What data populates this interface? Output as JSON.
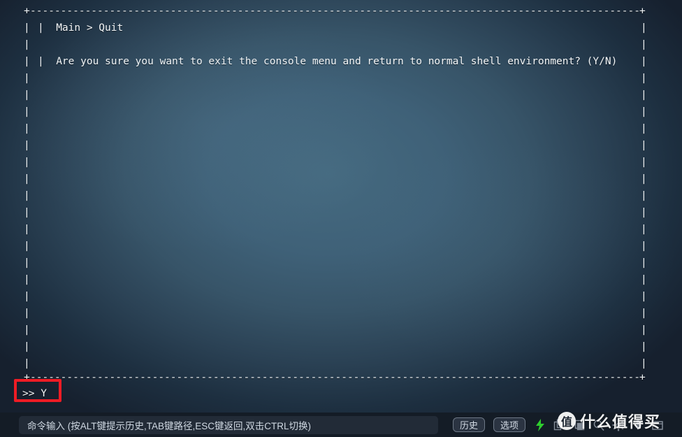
{
  "terminal": {
    "frame": {
      "corner_char": "+",
      "dash_char": "-",
      "dash_line": "-------------------------------------------------------------------------------------------------------------------------------------------------------------------------------------------------",
      "pipe_char": "|",
      "pipe_column": "|\n|\n|\n|\n|\n|\n|\n|\n|\n|\n|\n|\n|\n|\n|\n|\n|\n|\n|\n|\n|"
    },
    "breadcrumb": "|  Main > Quit",
    "prompt_text": "|  Are you sure you want to exit the console menu and return to normal shell environment? (Y/N)",
    "echo_line": ">> Y",
    "text_color": "#f4f7f9",
    "background_center_color": "#456a80",
    "background_edge_color": "#16202e"
  },
  "annotation": {
    "color": "#ee1c25",
    "target": "echo-line"
  },
  "bottom_bar": {
    "input_placeholder": "命令输入 (按ALT键提示历史,TAB键路径,ESC键返回,双击CTRL切换)",
    "input_value": "",
    "buttons": [
      {
        "id": "history",
        "label": "历史"
      },
      {
        "id": "options",
        "label": "选项"
      }
    ],
    "icons": [
      {
        "name": "lightning-bolt-icon",
        "color": "#2ecc2e"
      },
      {
        "name": "copy-icon",
        "color": "#aeb8c4"
      },
      {
        "name": "paste-icon",
        "color": "#aeb8c4"
      },
      {
        "name": "search-icon",
        "color": "#aeb8c4"
      },
      {
        "name": "gear-icon",
        "color": "#aeb8c4"
      },
      {
        "name": "download-icon",
        "color": "#aeb8c4"
      },
      {
        "name": "window-icon",
        "color": "#aeb8c4"
      }
    ]
  },
  "watermark": {
    "logo_char": "值",
    "text": "什么值得买"
  }
}
